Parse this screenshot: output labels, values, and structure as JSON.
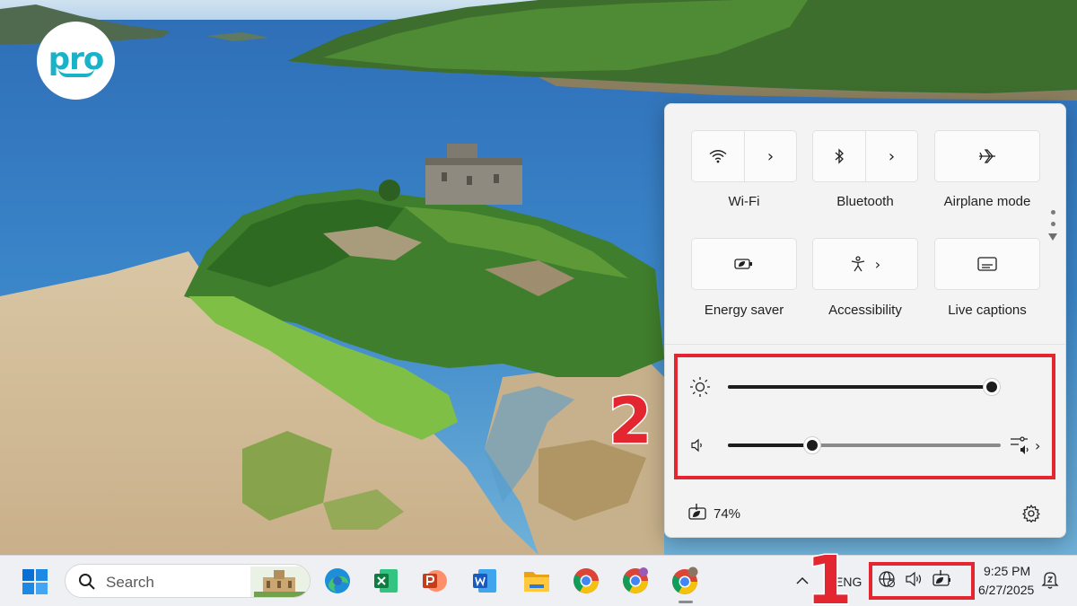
{
  "logo": {
    "text": "pro",
    "color": "#19b3c9"
  },
  "quick_settings": {
    "tiles": [
      {
        "label": "Wi-Fi",
        "icon": "wifi-icon",
        "has_chevron": true
      },
      {
        "label": "Bluetooth",
        "icon": "bluetooth-icon",
        "has_chevron": true
      },
      {
        "label": "Airplane mode",
        "icon": "airplane-icon",
        "has_chevron": false
      },
      {
        "label": "Energy saver",
        "icon": "energy-saver-icon",
        "has_chevron": false
      },
      {
        "label": "Accessibility",
        "icon": "accessibility-icon",
        "has_chevron": true
      },
      {
        "label": "Live captions",
        "icon": "live-captions-icon",
        "has_chevron": false
      }
    ],
    "brightness_level": 1.0,
    "volume_level": 0.31,
    "battery_text": "74%"
  },
  "annotations": {
    "label_1": "1",
    "label_2": "2",
    "color": "#e3262f"
  },
  "taskbar": {
    "search_placeholder": "Search",
    "apps": [
      "edge-icon",
      "excel-icon",
      "powerpoint-icon",
      "word-icon",
      "file-explorer-icon",
      "chrome-icon",
      "chrome-profile-y-icon",
      "chrome-profile-n-icon"
    ],
    "language": "ENG",
    "time": "9:25 PM",
    "date": "6/27/2025"
  }
}
